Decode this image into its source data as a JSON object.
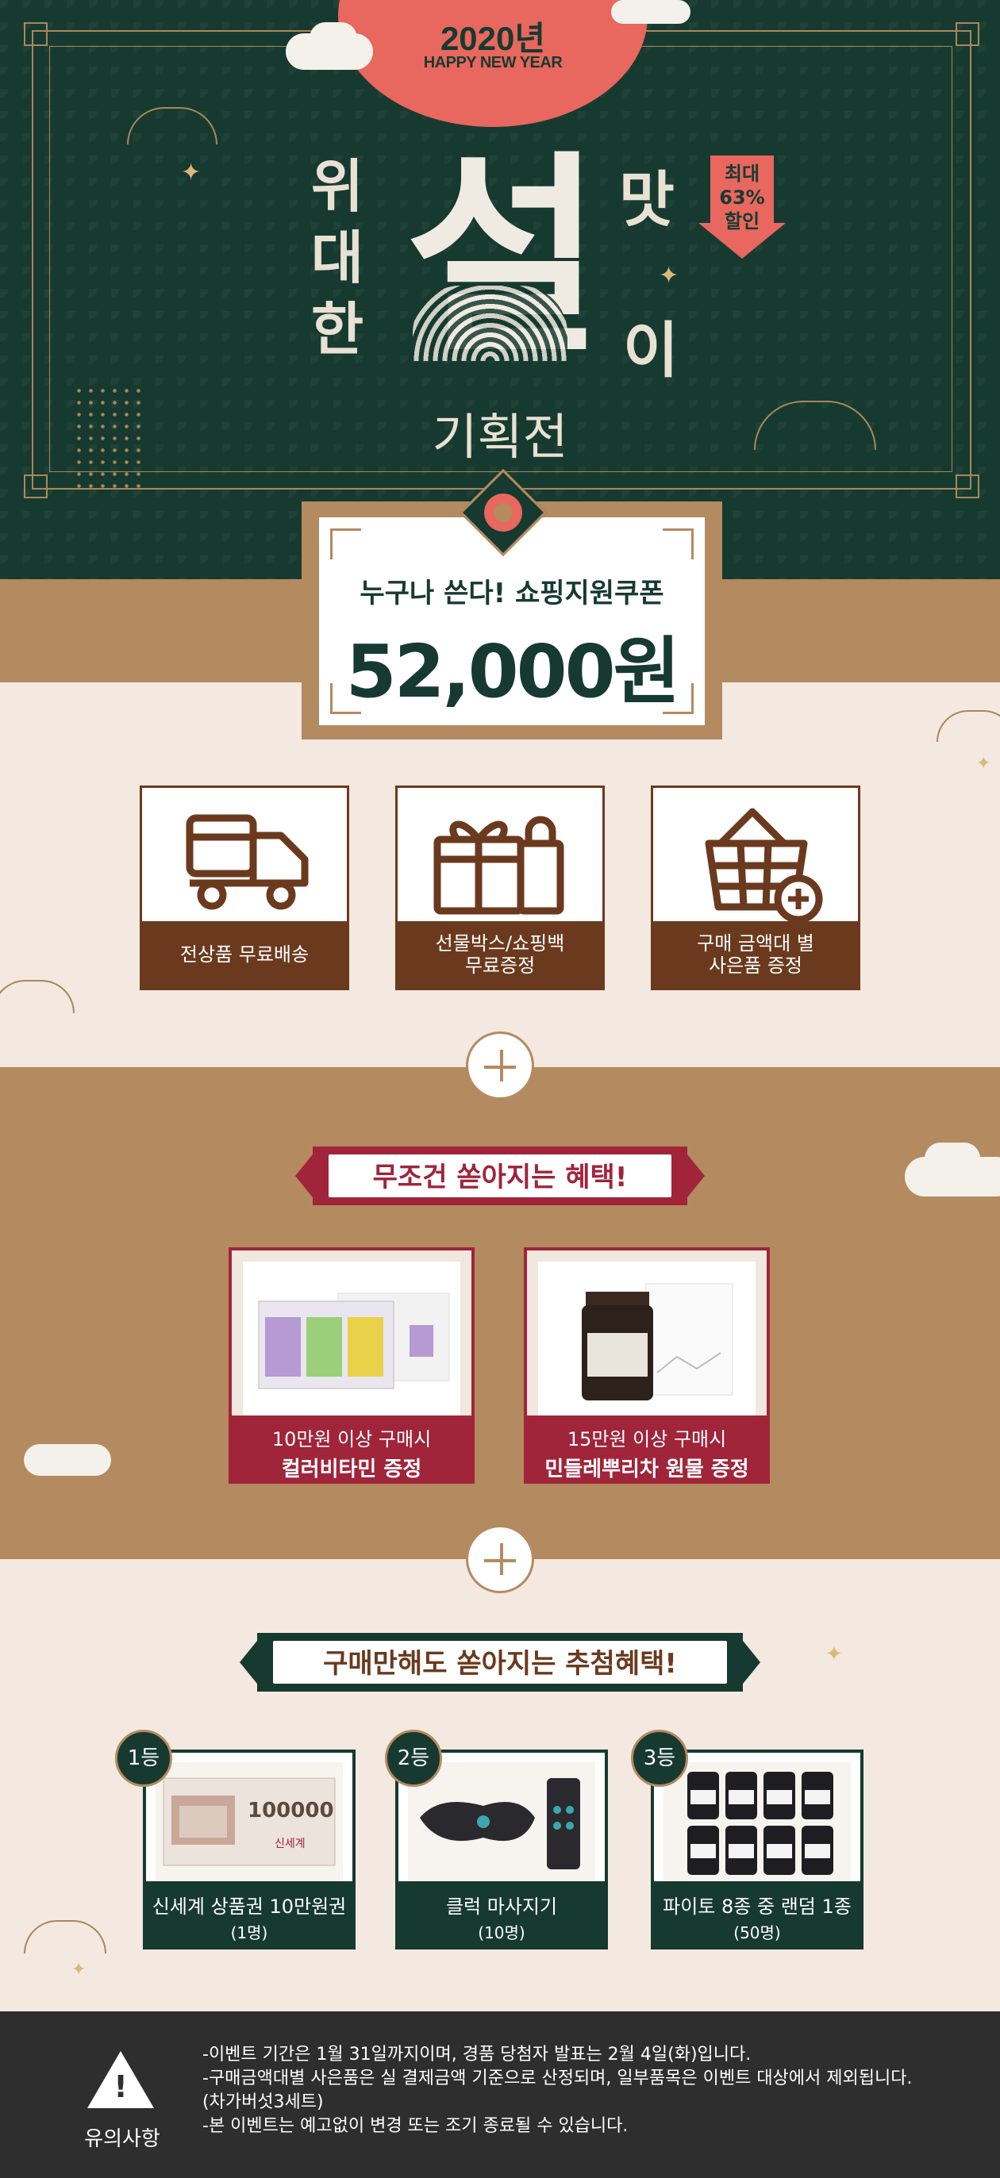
{
  "hero": {
    "year": "2020년",
    "year_sub": "HAPPY NEW YEAR",
    "col_chars": [
      "위",
      "대",
      "한"
    ],
    "big_char": "설",
    "right_top": "맛",
    "right_bottom": "이",
    "subtitle": "기획전",
    "discount_lines": [
      "최대",
      "63%",
      "할인"
    ]
  },
  "coupon": {
    "label": "누구나 쓴다! 쇼핑지원쿠폰",
    "value": "52,000원"
  },
  "services": [
    {
      "label": "전상품 무료배송",
      "icon": "truck-icon"
    },
    {
      "label": "선물박스/쇼핑백\n무료증정",
      "icon": "gift-bag-icon"
    },
    {
      "label": "구매 금액대 별\n사은품 증정",
      "icon": "basket-plus-icon"
    }
  ],
  "gifts_section": {
    "title": "무조건 쏟아지는 혜택!",
    "items": [
      {
        "line1": "10만원 이상 구매시",
        "line2": "컬러비타민 증정"
      },
      {
        "line1": "15만원 이상 구매시",
        "line2": "민들레뿌리차 원물 증정"
      }
    ]
  },
  "prizes_section": {
    "title": "구매만해도 쏟아지는 추첨혜택!",
    "items": [
      {
        "rank": "1등",
        "line1": "신세계 상품권 10만원권",
        "line2": "(1명)",
        "voucher_amount": "100000",
        "voucher_brand": "신세계"
      },
      {
        "rank": "2등",
        "line1": "클럭 마사지기",
        "line2": "(10명)"
      },
      {
        "rank": "3등",
        "line1": "파이토 8종 중 랜덤 1종",
        "line2": "(50명)"
      }
    ]
  },
  "notice": {
    "label": "유의사항",
    "lines": [
      "-이벤트 기간은 1월 31일까지이며, 경품 당첨자 발표는 2월 4일(화)입니다.",
      "-구매금액대별 사은품은 실 결제금액 기준으로 산정되며, 일부품목은 이벤트 대상에서 제외됩니다.",
      "  (차가버섯3세트)",
      "-본 이벤트는 예고없이 변경 또는 조기 종료될 수 있습니다."
    ]
  },
  "colors": {
    "dark_green": "#173a30",
    "gold": "#a8885a",
    "coral": "#e8675e",
    "tan": "#b48a60",
    "brown": "#6b3a1e",
    "crimson": "#a0243a",
    "cream": "#f3e9e0",
    "notice_bg": "#2e2e2e"
  }
}
